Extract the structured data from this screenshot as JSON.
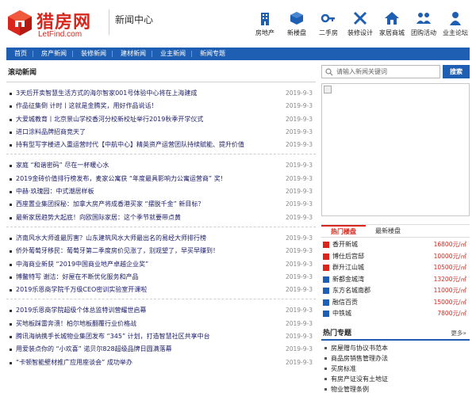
{
  "header": {
    "brand": "猎房网",
    "url": "LetFind.com",
    "channel": "新闻中心",
    "nav": [
      {
        "label": "房地产",
        "icon": "building-icon"
      },
      {
        "label": "新楼盘",
        "icon": "cube-icon"
      },
      {
        "label": "二手房",
        "icon": "key-icon"
      },
      {
        "label": "装修设计",
        "icon": "tools-icon"
      },
      {
        "label": "家居商城",
        "icon": "home-icon"
      },
      {
        "label": "团购活动",
        "icon": "users-icon"
      },
      {
        "label": "业主论坛",
        "icon": "person-icon"
      }
    ]
  },
  "menubar": [
    "首页",
    "房产新闻",
    "装修新闻",
    "建材新闻",
    "业主新闻",
    "新闻专题"
  ],
  "left": {
    "title": "滚动新闻",
    "groups": [
      [
        {
          "t": "3天后开卖智慧生活方式的海尔智家001号体验中心将在上海建成",
          "d": "2019-9-3"
        },
        {
          "t": "作品征集倒 计时丨这就是金腾奖，用好作品说话！",
          "d": "2019-9-3"
        },
        {
          "t": "大爱城教育丨北京景山学校香河分校新校址举行2019秋季开学仪式",
          "d": "2019-9-3"
        },
        {
          "t": "进口涂料品牌招商竞天了",
          "d": "2019-9-3"
        },
        {
          "t": "持有型写字楼进入重运营时代【中航中心】精英资产运营团队持续赋能、提升价值",
          "d": "2019-9-3"
        }
      ],
      [
        {
          "t": "家庭 “和谐密码” 尽在一杯暖心水",
          "d": "2019-9-3"
        },
        {
          "t": "2019金砖价值排行榜发布，麦家公寓获 “年度最具影响力公寓运营商” 奖!",
          "d": "2019-9-3"
        },
        {
          "t": "中赫·玖瑰园：中式潮居样板",
          "d": "2019-9-3"
        },
        {
          "t": "西座置业集团探秘：加拿大房产将成香港买家 “摆脱千金” 新目标？",
          "d": "2019-9-3"
        },
        {
          "t": "最新家居趋势大起底！向欧国际家居：这个季节就要带点黄",
          "d": "2019-9-3"
        }
      ],
      [
        {
          "t": "济南风水大师谁最厉害？山东建筑风水大师最出名的易经大师排行榜",
          "d": "2019-9-3"
        },
        {
          "t": "侨外葡萄牙移民：葡萄牙第二季度房价见涨了，别观望了，早买早赚到！",
          "d": "2019-9-3"
        },
        {
          "t": "中海商业新获 “2019中国商业地产卓越企业奖”",
          "d": "2019-9-3"
        },
        {
          "t": "博鳌特写 谢洁：好屋在不断优化服务和产品",
          "d": "2019-9-3"
        },
        {
          "t": "2019乐恩商学院千万级CEO密训实验室开课啦",
          "d": "2019-9-3"
        }
      ],
      [
        {
          "t": "2019乐恩商学院超级个体总监特训营耀世启幕",
          "d": "2019-9-3"
        },
        {
          "t": "买地板踩雷奔溃！柏尔地板翻覆行业价格战",
          "d": "2019-9-3"
        },
        {
          "t": "腾讯海纳携手长城物业集团发布 “345” 计划，打造智慧社区共享中台",
          "d": "2019-9-3"
        },
        {
          "t": "用爱装点你的 “小欢喜” 诺贝尔828超级品牌日圆满落幕",
          "d": "2019-9-3"
        },
        {
          "t": "“卡顿智能壁材推广应用座谈会” 成功举办",
          "d": "2019-9-3"
        }
      ]
    ]
  },
  "right": {
    "search": {
      "placeholder": "请输入新闻关键词",
      "button": "搜索"
    },
    "hot": {
      "tabs": [
        "热门楼盘",
        "最新楼盘"
      ],
      "items": [
        {
          "name": "香开新城",
          "price": "16800元/㎡"
        },
        {
          "name": "博仕后宫邸",
          "price": "10000元/㎡"
        },
        {
          "name": "群升江山城",
          "price": "10500元/㎡"
        },
        {
          "name": "新都金城湾",
          "price": "13200元/㎡"
        },
        {
          "name": "东方名城南郡",
          "price": "11000元/㎡"
        },
        {
          "name": "融信百贡",
          "price": "15000元/㎡"
        },
        {
          "name": "中铁城",
          "price": "7800元/㎡"
        }
      ]
    },
    "topic": {
      "title": "热门专题",
      "more": "更多»",
      "items": [
        "房屋赠与协议书范本",
        "商品房销售管理办法",
        "买房标准",
        "有房产证没有土地证",
        "物业管理条例"
      ]
    }
  },
  "colors": {
    "brand_red": "#d8261c",
    "nav_blue": "#1e5fb4"
  }
}
